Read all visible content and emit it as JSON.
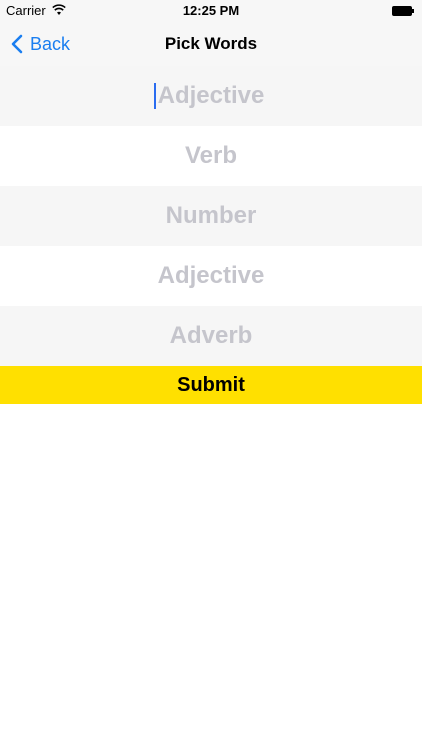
{
  "status_bar": {
    "carrier": "Carrier",
    "time": "12:25 PM",
    "wifi_icon": "wifi-icon",
    "battery_icon": "battery-icon"
  },
  "nav": {
    "back_label": "Back",
    "title": "Pick Words",
    "accent_color": "#1a7ef0"
  },
  "fields": [
    {
      "placeholder": "Adjective",
      "value": ""
    },
    {
      "placeholder": "Verb",
      "value": ""
    },
    {
      "placeholder": "Number",
      "value": ""
    },
    {
      "placeholder": "Adjective",
      "value": ""
    },
    {
      "placeholder": "Adverb",
      "value": ""
    }
  ],
  "submit": {
    "label": "Submit",
    "color": "#ffe000"
  }
}
